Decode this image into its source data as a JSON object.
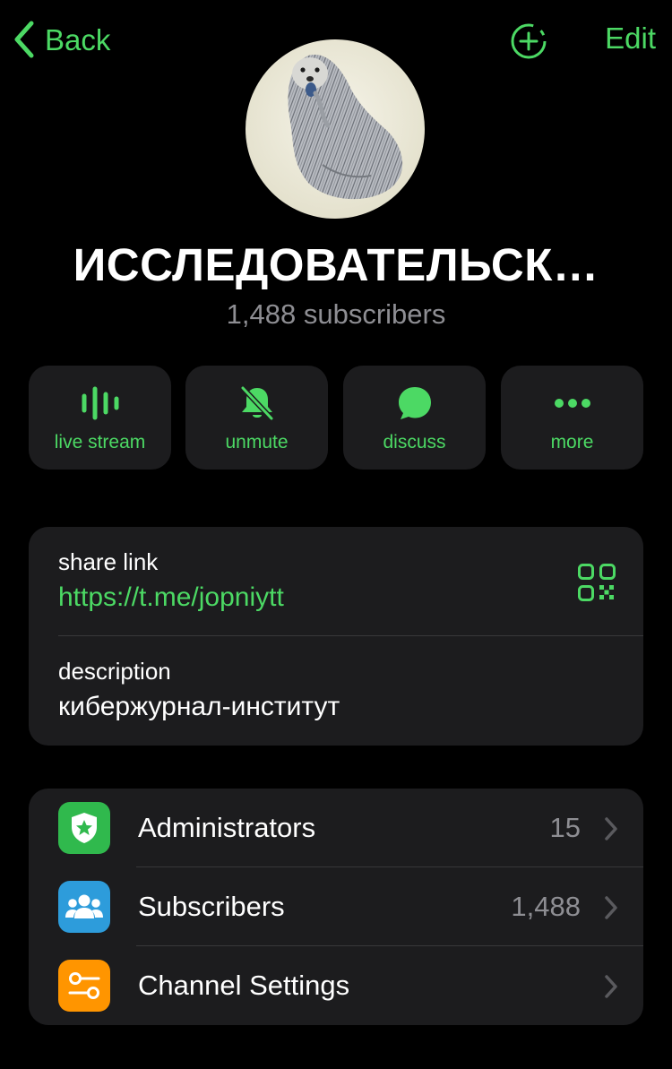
{
  "nav": {
    "back_label": "Back",
    "back_icon": "chevron-left-icon",
    "add_icon": "add-circle-dashed-icon",
    "edit_label": "Edit"
  },
  "profile": {
    "title": "ИССЛЕДОВАТЕЛЬСК…",
    "subscribers_text": "1,488 subscribers",
    "avatar": "hedgehog-illustration"
  },
  "actions": [
    {
      "label": "live stream",
      "icon": "live-stream-icon"
    },
    {
      "label": "unmute",
      "icon": "bell-slash-icon"
    },
    {
      "label": "discuss",
      "icon": "chat-bubble-icon"
    },
    {
      "label": "more",
      "icon": "more-dots-icon"
    }
  ],
  "info": {
    "link_label": "share link",
    "link_value": "https://t.me/jopniytt",
    "description_label": "description",
    "description_value": "кибержурнал-институт",
    "qr_icon": "qr-code-icon"
  },
  "list": [
    {
      "label": "Administrators",
      "value": "15",
      "icon": "shield-star-icon",
      "color": "#30b94d"
    },
    {
      "label": "Subscribers",
      "value": "1,488",
      "icon": "people-icon",
      "color": "#2d9cdb"
    },
    {
      "label": "Channel Settings",
      "value": "",
      "icon": "toggles-icon",
      "color": "#ff9500"
    }
  ],
  "colors": {
    "accent": "#4cd964",
    "background": "#000000",
    "card": "#1c1c1e",
    "secondary_text": "#8e8e93"
  }
}
